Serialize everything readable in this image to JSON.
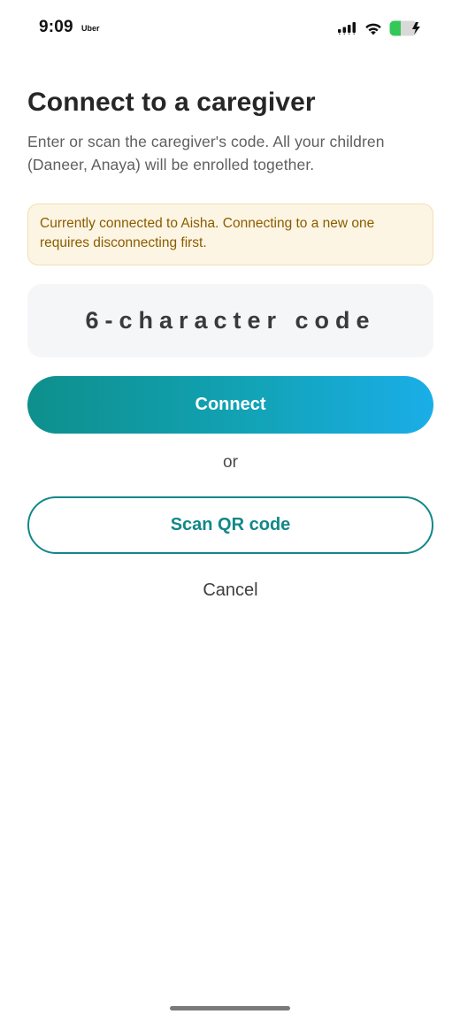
{
  "status_bar": {
    "time": "9:09",
    "app_label": "Uber",
    "battery_color": "#34c759"
  },
  "page": {
    "title": "Connect to a caregiver",
    "subtitle": "Enter or scan the caregiver's code. All your children (Daneer, Anaya) will be enrolled together."
  },
  "notice": {
    "text": "Currently connected to Aisha. Connecting to a new one requires disconnecting first."
  },
  "code_input": {
    "placeholder": "6-character code",
    "value": ""
  },
  "actions": {
    "connect_label": "Connect",
    "or_label": "or",
    "scan_label": "Scan QR code",
    "cancel_label": "Cancel"
  },
  "colors": {
    "accent_teal": "#12878a",
    "gradient_start": "#0e8f8c",
    "gradient_end": "#1aaee8",
    "notice_background": "#fdf5e3",
    "notice_text": "#8a5c00"
  }
}
